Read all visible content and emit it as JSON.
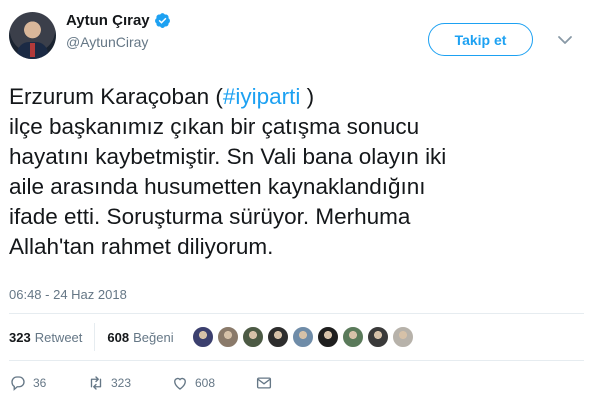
{
  "user": {
    "display_name": "Aytun Çıray",
    "handle": "@AytunCiray",
    "verified_icon": "verified-badge-icon"
  },
  "follow_button": {
    "label": "Takip et"
  },
  "menu": {
    "icon": "chevron-down-icon"
  },
  "tweet": {
    "lines": [
      {
        "pre": "Erzurum Karaçoban (",
        "hashtag": "#iyiparti",
        "post": " )"
      },
      {
        "text": "ilçe başkanımız çıkan bir çatışma sonucu"
      },
      {
        "text": "hayatını kaybetmiştir. Sn Vali bana olayın iki"
      },
      {
        "text": "aile arasında husumetten kaynaklandığını"
      },
      {
        "text": "ifade etti. Soruşturma sürüyor. Merhuma"
      },
      {
        "text": "Allah'tan rahmet diliyorum."
      }
    ],
    "timestamp": "06:48 - 24 Haz 2018"
  },
  "stats": {
    "retweets": {
      "count": "323",
      "label": "Retweet"
    },
    "likes": {
      "count": "608",
      "label": "Beğeni"
    }
  },
  "likers": [
    "#3b3f6e",
    "#8a7a6a",
    "#4c5a44",
    "#2d2d2d",
    "#6f8ca8",
    "#1e1e1e",
    "#5a7a5a",
    "#3a3a3a",
    "#b7b2aa"
  ],
  "actions": {
    "reply": {
      "icon": "reply-icon",
      "count": "36"
    },
    "retweet": {
      "icon": "retweet-icon",
      "count": "323"
    },
    "like": {
      "icon": "heart-icon",
      "count": "608"
    },
    "dm": {
      "icon": "envelope-icon"
    }
  },
  "colors": {
    "accent": "#1da1f2",
    "muted": "#657786",
    "text": "#14171a",
    "border": "#e6ecf0"
  }
}
